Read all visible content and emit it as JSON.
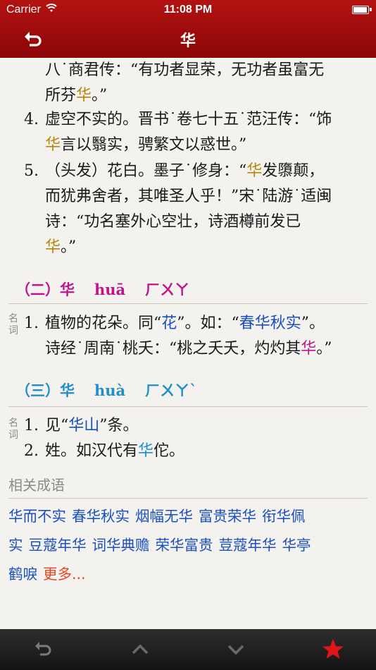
{
  "status": {
    "carrier": "Carrier",
    "time": "11:08 PM"
  },
  "nav": {
    "title": "华"
  },
  "defs_top": {
    "line1": "八˙商君传：“有功者显荣，无功者虽富无",
    "line2a": "所芬",
    "line2b": "华",
    "line2c": "。”",
    "d4_num": "4.",
    "d4_l1": "虚空不实的。晋书˙卷七十五˙范汪传：“饰",
    "d4_l2a": "华",
    "d4_l2b": "言以翳实，骋繁文以惑世。”",
    "d5_num": "5.",
    "d5_l1a": "（头发）花白。墨子˙修身：“",
    "d5_l1b": "华",
    "d5_l1c": "发隳颠，",
    "d5_l2": "而犹弗舍者，其唯圣人乎！”宋˙陆游˙适闽",
    "d5_l3": "诗：“功名塞外心空壮，诗酒樽前发已",
    "d5_l4a": "华",
    "d5_l4b": "。”"
  },
  "section2": {
    "index": "（二）",
    "char": "华",
    "pinyin": "huā",
    "zhuyin": "ㄏㄨㄚ",
    "pos": "名词",
    "d1_num": "1.",
    "d1_l1a": "植物的花朵。同“",
    "d1_l1b": "花",
    "d1_l1c": "”。如：“",
    "d1_l1d": "春华秋实",
    "d1_l1e": "”。",
    "d1_l2a": "诗经˙周南˙桃夭：“桃之夭夭，灼灼其",
    "d1_l2b": "华",
    "d1_l2c": "。”"
  },
  "section3": {
    "index": "（三）",
    "char": "华",
    "pinyin": "huà",
    "zhuyin": "ㄏㄨㄚˋ",
    "pos": "名词",
    "d1_num": "1.",
    "d1a": "见“",
    "d1b": "华山",
    "d1c": "”条。",
    "d2_num": "2.",
    "d2a": "姓。如汉代有",
    "d2b": "华",
    "d2c": "佗。"
  },
  "related": {
    "title": "相关成语",
    "idioms": [
      "华而不实",
      "春华秋实",
      "烟幅无华",
      "富贵荣华",
      "衔华佩",
      "实",
      "豆蔻年华",
      "词华典赡",
      "荣华富贵",
      "荳蔻年华",
      "华亭",
      "鹤唳"
    ],
    "more": "更多..."
  },
  "colors": {
    "nav_red": "#a00d0d",
    "gold": "#b8860b",
    "magenta": "#c0138c",
    "cyan": "#1f8fc9",
    "link_blue": "#1a4fbf",
    "more_orange": "#e8431c",
    "star_red": "#e0151b"
  },
  "icons": [
    "wifi-icon",
    "battery-icon",
    "back-arrow-icon",
    "undo-icon",
    "chevron-up-icon",
    "chevron-down-icon",
    "star-icon"
  ]
}
